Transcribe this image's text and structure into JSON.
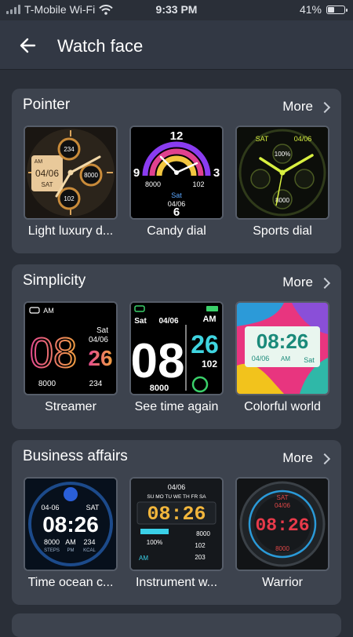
{
  "status_bar": {
    "carrier": "T-Mobile Wi-Fi",
    "time": "9:33 PM",
    "battery": "41%",
    "battery_level": 0.41
  },
  "header": {
    "title": "Watch face",
    "back_icon": "arrow-left-icon"
  },
  "sections": [
    {
      "title": "Pointer",
      "more_label": "More",
      "faces": [
        {
          "label": "Light luxury d...",
          "texts": {
            "t1": "234",
            "t2": "AM",
            "t3": "04/06",
            "t4": "SAT",
            "t5": "8000",
            "t6": "102"
          }
        },
        {
          "label": "Candy dial",
          "texts": {
            "t1": "12",
            "t2": "9",
            "t3": "3",
            "t4": "6",
            "t5": "8000",
            "t6": "102",
            "t7": "Sat",
            "t8": "04/06"
          }
        },
        {
          "label": "Sports dial",
          "texts": {
            "t1": "SAT",
            "t2": "04/06",
            "t3": "100%",
            "t4": "8000"
          }
        }
      ]
    },
    {
      "title": "Simplicity",
      "more_label": "More",
      "faces": [
        {
          "label": "Streamer",
          "texts": {
            "t1": "AM",
            "t2": "Sat",
            "t3": "04/06",
            "t4": "08",
            "t5": "26",
            "t6": "8000",
            "t7": "234"
          }
        },
        {
          "label": "See time again",
          "texts": {
            "t1": "Sat",
            "t2": "04/06",
            "t3": "AM",
            "t4": "08",
            "t5": "26",
            "t6": "102",
            "t7": "8000"
          }
        },
        {
          "label": "Colorful world",
          "texts": {
            "t1": "08:26",
            "t2": "04/06",
            "t3": "AM",
            "t4": "Sat"
          }
        }
      ]
    },
    {
      "title": "Business affairs",
      "more_label": "More",
      "faces": [
        {
          "label": "Time ocean c...",
          "texts": {
            "t1": "04-06",
            "t2": "SAT",
            "t3": "08:26",
            "t4": "8000",
            "t5": "STEPS",
            "t6": "AM",
            "t7": "PM",
            "t8": "234",
            "t9": "KCAL"
          }
        },
        {
          "label": "Instrument w...",
          "texts": {
            "t1": "04/06",
            "t2": "SU MO TU WE TH FR SA",
            "t3": "08:26",
            "t4": "8000",
            "t5": "100%",
            "t6": "102",
            "t7": "AM",
            "t8": "203"
          }
        },
        {
          "label": "Warrior",
          "texts": {
            "t1": "SAT",
            "t2": "04/06",
            "t3": "08:26",
            "t4": "8000"
          }
        }
      ]
    }
  ],
  "colors": {
    "background": "#2a2f38",
    "card": "#3d434e",
    "nav": "#323844"
  }
}
